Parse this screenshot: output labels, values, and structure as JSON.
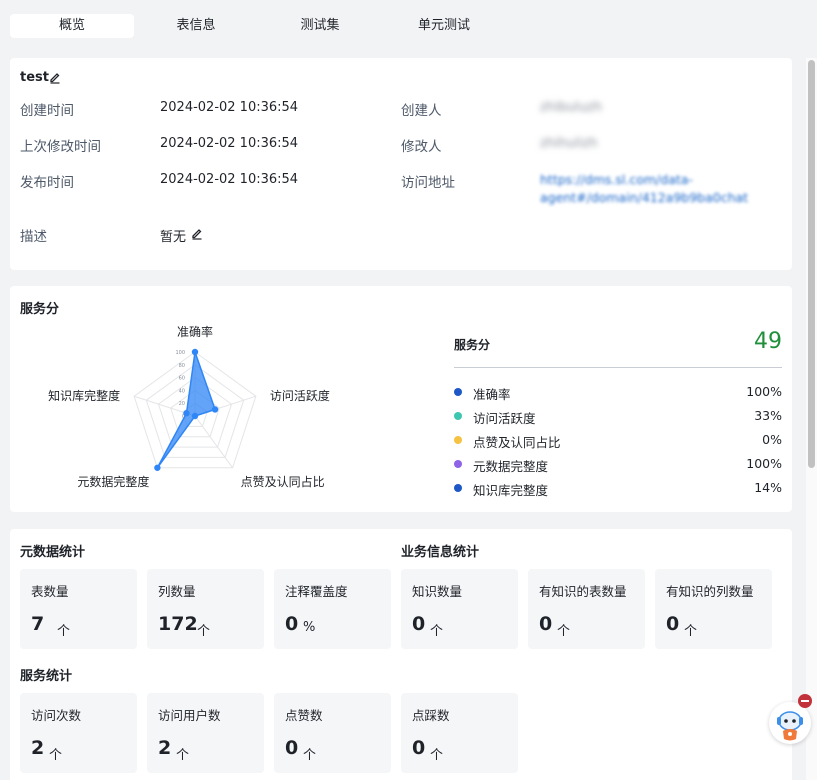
{
  "tabs": [
    {
      "label": "概览",
      "active": true
    },
    {
      "label": "表信息",
      "active": false
    },
    {
      "label": "测试集",
      "active": false
    },
    {
      "label": "单元测试",
      "active": false
    }
  ],
  "info": {
    "name": "test",
    "created_time_label": "创建时间",
    "created_time": "2024-02-02 10:36:54",
    "modified_time_label": "上次修改时间",
    "modified_time": "2024-02-02 10:36:54",
    "published_time_label": "发布时间",
    "published_time": "2024-02-02 10:36:54",
    "creator_label": "创建人",
    "creator": "zhibuluzh",
    "modifier_label": "修改人",
    "modifier": "zhihulizh",
    "url_label": "访问地址",
    "url_line1": "https://dms.sl.com/data-",
    "url_line2": "agent#/domain/412a9b9ba0chat",
    "desc_label": "描述",
    "desc_value": "暂无"
  },
  "service_score": {
    "title": "服务分",
    "score_label": "服务分",
    "score": "49",
    "metrics": [
      {
        "name": "准确率",
        "value": "100%",
        "color": "#1d58c6"
      },
      {
        "name": "访问活跃度",
        "value": "33%",
        "color": "#3ec7b0"
      },
      {
        "name": "点赞及认同占比",
        "value": "0%",
        "color": "#f5c242"
      },
      {
        "name": "元数据完整度",
        "value": "100%",
        "color": "#8e63e8"
      },
      {
        "name": "知识库完整度",
        "value": "14%",
        "color": "#1d58c6"
      }
    ]
  },
  "chart_data": {
    "type": "radar",
    "categories": [
      "准确率",
      "访问活跃度",
      "点赞及认同占比",
      "元数据完整度",
      "知识库完整度"
    ],
    "values": [
      100,
      33,
      0,
      100,
      14
    ],
    "ticks": [
      "0",
      "20",
      "40",
      "60",
      "80",
      "100"
    ],
    "range": [
      0,
      100
    ],
    "grid": true,
    "color": "#2f86f6"
  },
  "metadata_stats": {
    "title": "元数据统计",
    "items": [
      {
        "label": "表数量",
        "value": "7",
        "unit": "个"
      },
      {
        "label": "列数量",
        "value": "172",
        "unit": "个"
      },
      {
        "label": "注释覆盖度",
        "value": "0",
        "unit": "%"
      }
    ]
  },
  "business_stats": {
    "title": "业务信息统计",
    "items": [
      {
        "label": "知识数量",
        "value": "0",
        "unit": "个"
      },
      {
        "label": "有知识的表数量",
        "value": "0",
        "unit": "个"
      },
      {
        "label": "有知识的列数量",
        "value": "0",
        "unit": "个"
      }
    ]
  },
  "service_stats": {
    "title": "服务统计",
    "items": [
      {
        "label": "访问次数",
        "value": "2",
        "unit": "个"
      },
      {
        "label": "访问用户数",
        "value": "2",
        "unit": "个"
      },
      {
        "label": "点赞数",
        "value": "0",
        "unit": "个"
      },
      {
        "label": "点踩数",
        "value": "0",
        "unit": "个"
      }
    ]
  },
  "icons": {
    "edit": "edit-pencil-icon",
    "assistant": "assistant-robot-icon",
    "close": "minus-close-icon"
  }
}
